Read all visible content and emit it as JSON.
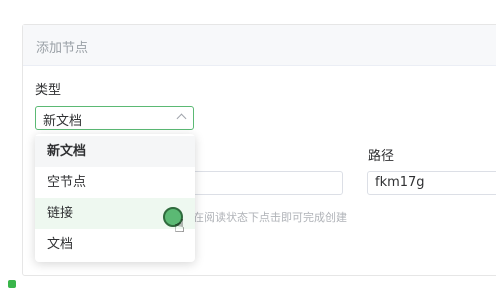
{
  "panel": {
    "title": "添加节点"
  },
  "form": {
    "type_label": "类型",
    "type_value": "新文档",
    "path_label": "路径",
    "path_value": "fkm17g",
    "hint": "在阅读状态下点击即可完成创建"
  },
  "dropdown": {
    "options": [
      {
        "label": "新文档"
      },
      {
        "label": "空节点"
      },
      {
        "label": "链接"
      },
      {
        "label": "文档"
      }
    ]
  },
  "colors": {
    "accent": "#5bb974",
    "hover_bg": "#eef8f0",
    "selected_bg": "#f5f6f7"
  }
}
